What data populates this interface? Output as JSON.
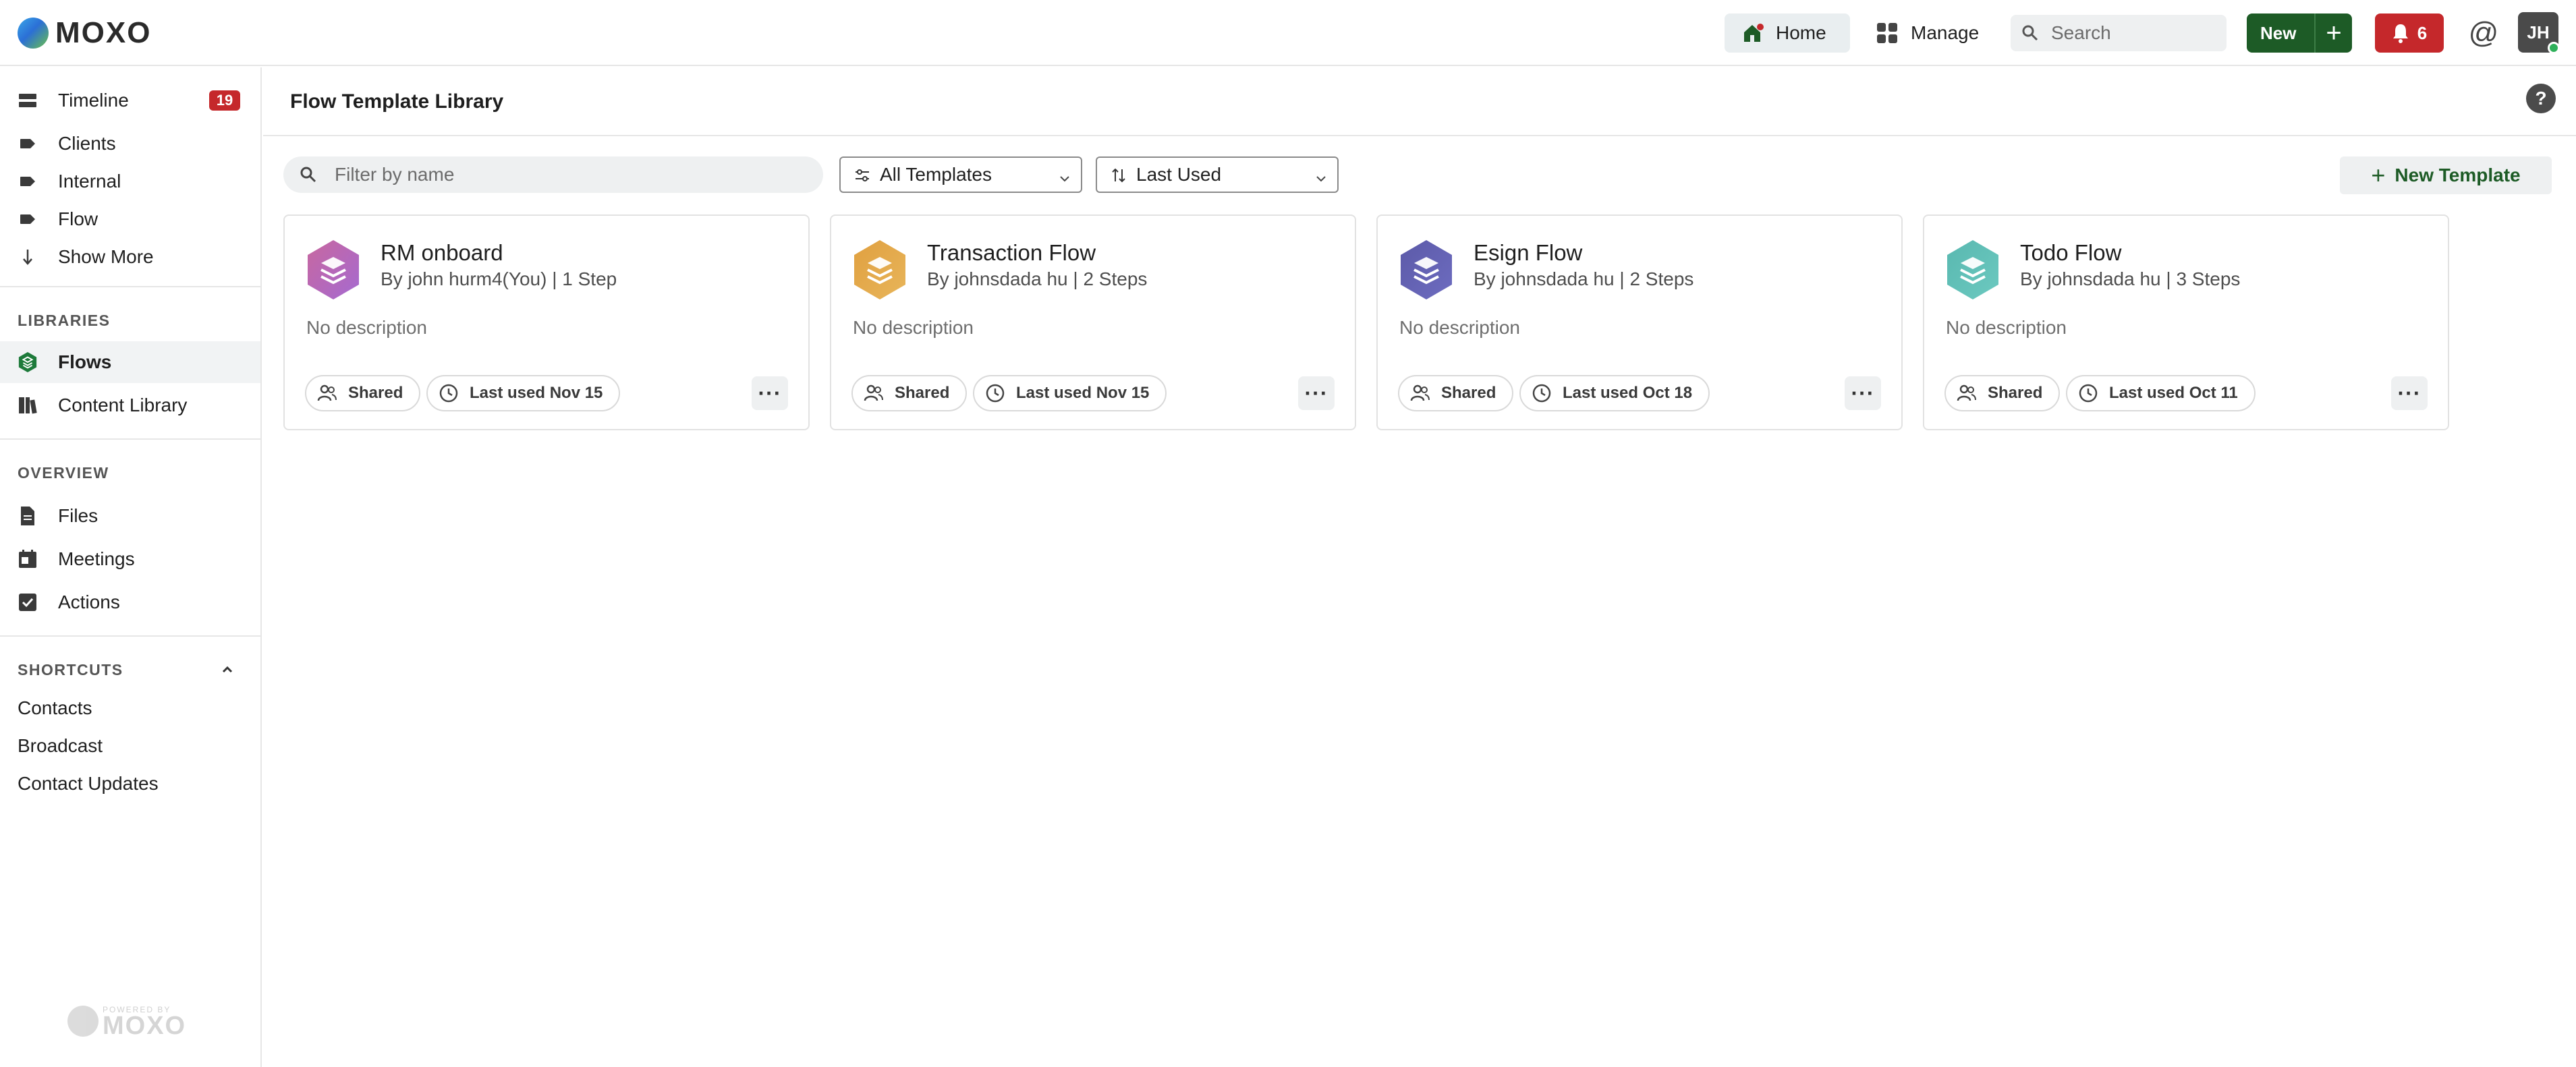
{
  "app": {
    "brand": "MOXO"
  },
  "topbar": {
    "home_label": "Home",
    "manage_label": "Manage",
    "search_placeholder": "Search",
    "new_label": "New",
    "new_plus": "+",
    "notifications_count": "6",
    "mentions_icon": "@",
    "avatar_initials": "JH"
  },
  "sidebar": {
    "nav": [
      {
        "label": "Timeline",
        "icon": "timeline-icon",
        "badge": "19"
      },
      {
        "label": "Clients",
        "icon": "tag-icon"
      },
      {
        "label": "Internal",
        "icon": "tag-icon"
      },
      {
        "label": "Flow",
        "icon": "tag-icon"
      },
      {
        "label": "Show More",
        "icon": "arrow-down-icon"
      }
    ],
    "libraries_title": "LIBRARIES",
    "libraries": [
      {
        "label": "Flows",
        "icon": "flows-icon",
        "active": true
      },
      {
        "label": "Content Library",
        "icon": "library-icon"
      }
    ],
    "overview_title": "OVERVIEW",
    "overview": [
      {
        "label": "Files",
        "icon": "file-icon"
      },
      {
        "label": "Meetings",
        "icon": "calendar-icon"
      },
      {
        "label": "Actions",
        "icon": "checkbox-icon"
      }
    ],
    "shortcuts_title": "SHORTCUTS",
    "shortcuts": [
      "Contacts",
      "Broadcast",
      "Contact Updates"
    ],
    "powered_small": "POWERED BY",
    "powered_brand": "MOXO"
  },
  "main": {
    "page_title": "Flow Template Library",
    "help_icon": "?",
    "filter_placeholder": "Filter by name",
    "template_filter": "All Templates",
    "sort": "Last Used",
    "new_template_label": "New Template",
    "new_template_plus": "+",
    "cards": [
      {
        "title": "RM onboard",
        "meta": "By john hurm4(You)  | 1 Step",
        "description": "No description",
        "shared": "Shared",
        "last_used": "Last used Nov 15",
        "color": "#c8679f",
        "color2": "#a56ad1"
      },
      {
        "title": "Transaction Flow",
        "meta": "By johnsdada hu  | 2 Steps",
        "description": "No description",
        "shared": "Shared",
        "last_used": "Last used Nov 15",
        "color": "#e0a040",
        "color2": "#e8b55a"
      },
      {
        "title": "Esign Flow",
        "meta": "By johnsdada hu  | 2 Steps",
        "description": "No description",
        "shared": "Shared",
        "last_used": "Last used Oct 18",
        "color": "#5c5aa8",
        "color2": "#6d6cc0"
      },
      {
        "title": "Todo Flow",
        "meta": "By johnsdada hu  | 3 Steps",
        "description": "No description",
        "shared": "Shared",
        "last_used": "Last used Oct 11",
        "color": "#59b8b0",
        "color2": "#6cc9c0"
      }
    ],
    "more_label": "···"
  }
}
